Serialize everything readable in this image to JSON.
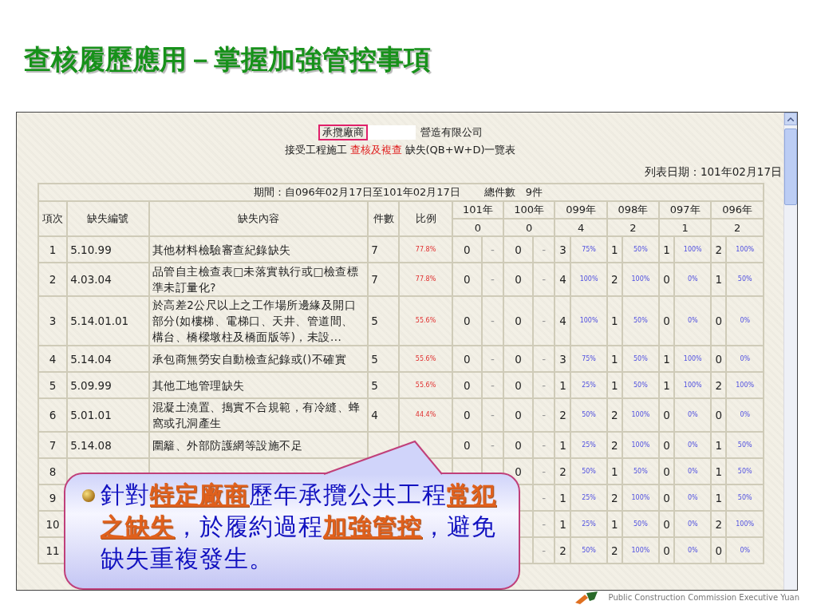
{
  "title": "查核履歷應用－掌握加強管控事項",
  "report": {
    "vendor_label": "承攬廠商",
    "company_suffix": "營造有限公司",
    "subtitle_prefix": "接受工程施工",
    "subtitle_link": "查核及複查",
    "subtitle_suffix": "缺失(QB+W+D)一覽表",
    "list_date": "列表日期：101年02月17日",
    "period": "期間：自096年02月17日至101年02月17日",
    "total": "總件數　9件"
  },
  "table": {
    "columns": [
      "項次",
      "缺失編號",
      "缺失內容",
      "件數",
      "比例"
    ],
    "years": [
      {
        "label": "101年",
        "total": "0"
      },
      {
        "label": "100年",
        "total": "0"
      },
      {
        "label": "099年",
        "total": "4"
      },
      {
        "label": "098年",
        "total": "2"
      },
      {
        "label": "097年",
        "total": "1"
      },
      {
        "label": "096年",
        "total": "2"
      }
    ],
    "rows": [
      {
        "no": "1",
        "code": "5.10.99",
        "description": "其他材料檢驗審查紀錄缺失",
        "count": "7",
        "ratio": "77.8%",
        "years": [
          {
            "count": "0",
            "share": "-"
          },
          {
            "count": "0",
            "share": "-"
          },
          {
            "count": "3",
            "share": "75%"
          },
          {
            "count": "1",
            "share": "50%"
          },
          {
            "count": "1",
            "share": "100%"
          },
          {
            "count": "2",
            "share": "100%"
          }
        ]
      },
      {
        "no": "2",
        "code": "4.03.04",
        "description": "品管自主檢查表□未落實執行或□檢查標準未訂量化?",
        "count": "7",
        "ratio": "77.8%",
        "years": [
          {
            "count": "0",
            "share": "-"
          },
          {
            "count": "0",
            "share": "-"
          },
          {
            "count": "4",
            "share": "100%"
          },
          {
            "count": "2",
            "share": "100%"
          },
          {
            "count": "0",
            "share": "0%"
          },
          {
            "count": "1",
            "share": "50%"
          }
        ]
      },
      {
        "no": "3",
        "code": "5.14.01.01",
        "description": "於高差2公尺以上之工作場所邊緣及開口部分(如樓梯、電梯口、天井、管道間、構台、橋樑墩柱及橋面版等)，未設...",
        "count": "5",
        "ratio": "55.6%",
        "years": [
          {
            "count": "0",
            "share": "-"
          },
          {
            "count": "0",
            "share": "-"
          },
          {
            "count": "4",
            "share": "100%"
          },
          {
            "count": "1",
            "share": "50%"
          },
          {
            "count": "0",
            "share": "0%"
          },
          {
            "count": "0",
            "share": "0%"
          }
        ]
      },
      {
        "no": "4",
        "code": "5.14.04",
        "description": "承包商無勞安自動檢查紀錄或()不確實",
        "count": "5",
        "ratio": "55.6%",
        "years": [
          {
            "count": "0",
            "share": "-"
          },
          {
            "count": "0",
            "share": "-"
          },
          {
            "count": "3",
            "share": "75%"
          },
          {
            "count": "1",
            "share": "50%"
          },
          {
            "count": "1",
            "share": "100%"
          },
          {
            "count": "0",
            "share": "0%"
          }
        ]
      },
      {
        "no": "5",
        "code": "5.09.99",
        "description": "其他工地管理缺失",
        "count": "5",
        "ratio": "55.6%",
        "years": [
          {
            "count": "0",
            "share": "-"
          },
          {
            "count": "0",
            "share": "-"
          },
          {
            "count": "1",
            "share": "25%"
          },
          {
            "count": "1",
            "share": "50%"
          },
          {
            "count": "1",
            "share": "100%"
          },
          {
            "count": "2",
            "share": "100%"
          }
        ]
      },
      {
        "no": "6",
        "code": "5.01.01",
        "description": "混凝土澆置、搗實不合規範，有冷縫、蜂窩或孔洞產生",
        "count": "4",
        "ratio": "44.4%",
        "years": [
          {
            "count": "0",
            "share": "-"
          },
          {
            "count": "0",
            "share": "-"
          },
          {
            "count": "2",
            "share": "50%"
          },
          {
            "count": "2",
            "share": "100%"
          },
          {
            "count": "0",
            "share": "0%"
          },
          {
            "count": "0",
            "share": "0%"
          }
        ]
      },
      {
        "no": "7",
        "code": "5.14.08",
        "description": "圍籬、外部防護網等設施不足",
        "years": [
          {
            "count": "0",
            "share": "-"
          },
          {
            "count": "0",
            "share": "-"
          },
          {
            "count": "1",
            "share": "25%"
          },
          {
            "count": "2",
            "share": "100%"
          },
          {
            "count": "0",
            "share": "0%"
          },
          {
            "count": "1",
            "share": "50%"
          }
        ]
      },
      {
        "no": "8",
        "years": [
          {
            "count": "0",
            "share": "-"
          },
          {
            "count": "2",
            "share": "50%"
          },
          {
            "count": "1",
            "share": "50%"
          },
          {
            "count": "0",
            "share": "0%"
          },
          {
            "count": "1",
            "share": "50%"
          }
        ]
      },
      {
        "no": "9",
        "years": [
          {
            "share": "-"
          },
          {
            "count": "1",
            "share": "25%"
          },
          {
            "count": "2",
            "share": "100%"
          },
          {
            "count": "0",
            "share": "0%"
          },
          {
            "count": "1",
            "share": "50%"
          }
        ]
      },
      {
        "no": "10",
        "years": [
          {
            "share": "-"
          },
          {
            "count": "1",
            "share": "25%"
          },
          {
            "count": "1",
            "share": "50%"
          },
          {
            "count": "0",
            "share": "0%"
          },
          {
            "count": "2",
            "share": "100%"
          }
        ]
      },
      {
        "no": "11",
        "years": [
          {
            "share": "-"
          },
          {
            "count": "2",
            "share": "50%"
          },
          {
            "count": "2",
            "share": "100%"
          },
          {
            "count": "0",
            "share": "0%"
          },
          {
            "count": "0",
            "share": "0%"
          }
        ]
      }
    ]
  },
  "callout": {
    "text": "針對**特定廠商**歷年承攬公共工程**常犯之缺失**，於履約過程**加強管控**，避免缺失重複發生。"
  },
  "footer_logo": {
    "text": "Public Construction Commission Executive Yuan"
  }
}
